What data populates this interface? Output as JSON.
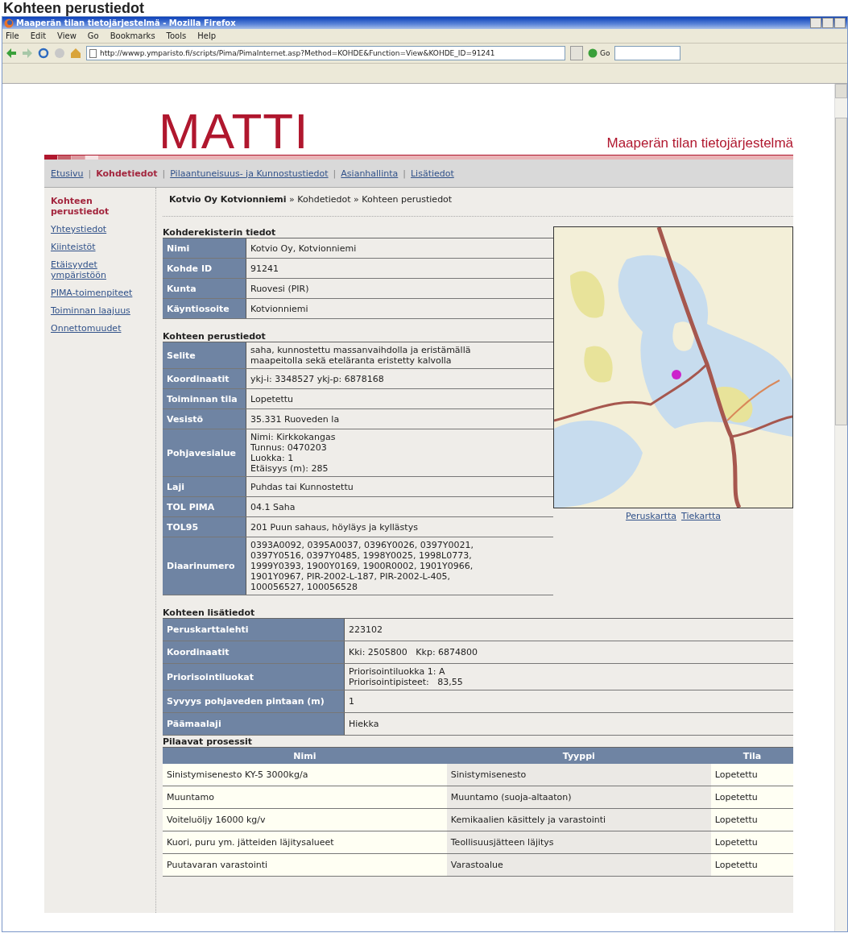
{
  "page_title": "Kohteen perustiedot",
  "window": {
    "title": "Maaperän tilan tietojärjestelmä - Mozilla Firefox",
    "menu": [
      "File",
      "Edit",
      "View",
      "Go",
      "Bookmarks",
      "Tools",
      "Help"
    ],
    "url": "http://wwwp.ymparisto.fi/scripts/Pima/PimaInternet.asp?Method=KOHDE&Function=View&KOHDE_ID=91241",
    "go_label": "Go"
  },
  "site": {
    "logo": "MATTI",
    "tagline": "Maaperän tilan tietojärjestelmä",
    "nav_separator": "|",
    "nav": [
      {
        "label": "Etusivu",
        "selected": false
      },
      {
        "label": "Kohdetiedot",
        "selected": true
      },
      {
        "label": "Pilaantuneisuus- ja Kunnostustiedot",
        "selected": false
      },
      {
        "label": "Asianhallinta",
        "selected": false
      },
      {
        "label": "Lisätiedot",
        "selected": false
      }
    ],
    "sidebar": [
      {
        "label": "Kohteen perustiedot",
        "selected": true
      },
      {
        "label": "Yhteystiedot",
        "selected": false
      },
      {
        "label": "Kiinteistöt",
        "selected": false
      },
      {
        "label": "Etäisyydet ympäristöön",
        "selected": false
      },
      {
        "label": "PIMA-toimenpiteet",
        "selected": false
      },
      {
        "label": "Toiminnan laajuus",
        "selected": false
      },
      {
        "label": "Onnettomuudet",
        "selected": false
      }
    ],
    "breadcrumb": "**Kotvio Oy Kotvionniemi** » Kohdetiedot » Kohteen perustiedot"
  },
  "register": {
    "heading": "Kohderekisterin tiedot",
    "rows": [
      {
        "label": "Nimi",
        "lines": [
          "Kotvio Oy, Kotvionniemi"
        ]
      },
      {
        "label": "Kohde ID",
        "lines": [
          "91241"
        ]
      },
      {
        "label": "Kunta",
        "lines": [
          "Ruovesi (PIR)"
        ]
      },
      {
        "label": "Käyntiosoite",
        "lines": [
          "Kotvionniemi"
        ]
      }
    ]
  },
  "basic": {
    "heading": "Kohteen perustiedot",
    "rows": [
      {
        "label": "Selite",
        "lines": [
          "saha, kunnostettu massanvaihdolla ja eristämällä",
          "maapeitolla sekä eteläranta eristetty kalvolla"
        ]
      },
      {
        "label": "Koordinaatit",
        "lines": [
          "ykj-i: 3348527 ykj-p: 6878168"
        ]
      },
      {
        "label": "Toiminnan tila",
        "lines": [
          "Lopetettu"
        ]
      },
      {
        "label": "Vesistö",
        "lines": [
          "35.331 Ruoveden la"
        ]
      },
      {
        "label": "Pohjavesialue",
        "lines": [
          "Nimi: Kirkkokangas",
          "Tunnus: 0470203",
          "Luokka: 1",
          "Etäisyys (m): 285"
        ]
      },
      {
        "label": "Laji",
        "lines": [
          "Puhdas tai Kunnostettu"
        ]
      },
      {
        "label": "TOL PIMA",
        "lines": [
          "04.1 Saha"
        ]
      },
      {
        "label": "TOL95",
        "lines": [
          "201 Puun sahaus, höyläys ja kyllästys"
        ]
      },
      {
        "label": "Diaarinumero",
        "lines": [
          "0393A0092, 0395A0037, 0396Y0026, 0397Y0021,",
          "0397Y0516, 0397Y0485, 1998Y0025, 1998L0773,",
          "1999Y0393, 1900Y0169, 1900R0002, 1901Y0966,",
          "1901Y0967, PIR-2002-L-187, PIR-2002-L-405,",
          "100056527, 100056528"
        ]
      }
    ]
  },
  "map": {
    "kind": "picture",
    "links": [
      "Peruskartta",
      "Tiekartta"
    ]
  },
  "extra": {
    "heading": "Kohteen lisätiedot",
    "rows": [
      {
        "label": "Peruskarttalehti",
        "lines": [
          "223102"
        ]
      },
      {
        "label": "Koordinaatit",
        "lines": [
          "Kki: 2505800   Kkp: 6874800"
        ]
      },
      {
        "label": "Priorisointiluokat",
        "lines": [
          "Priorisointiluokka 1: A",
          "Priorisointipisteet:   83,55"
        ]
      },
      {
        "label": "Syvyys pohjaveden pintaan (m)",
        "lines": [
          "1"
        ]
      },
      {
        "label": "Päämaalaji",
        "lines": [
          "Hiekka"
        ]
      }
    ]
  },
  "processes": {
    "heading": "Pilaavat prosessit",
    "columns": [
      "Nimi",
      "Tyyppi",
      "Tila"
    ],
    "rows": [
      [
        "Sinistymisenesto KY-5 3000kg/a",
        "Sinistymisenesto",
        "Lopetettu"
      ],
      [
        "Muuntamo",
        "Muuntamo (suoja-altaaton)",
        "Lopetettu"
      ],
      [
        "Voiteluöljy 16000 kg/v",
        "Kemikaalien käsittely ja varastointi",
        "Lopetettu"
      ],
      [
        "Kuori, puru ym. jätteiden läjitysalueet",
        "Teollisuusjätteen läjitys",
        "Lopetettu"
      ],
      [
        "Puutavaran varastointi",
        "Varastoalue",
        "Lopetettu"
      ]
    ]
  }
}
